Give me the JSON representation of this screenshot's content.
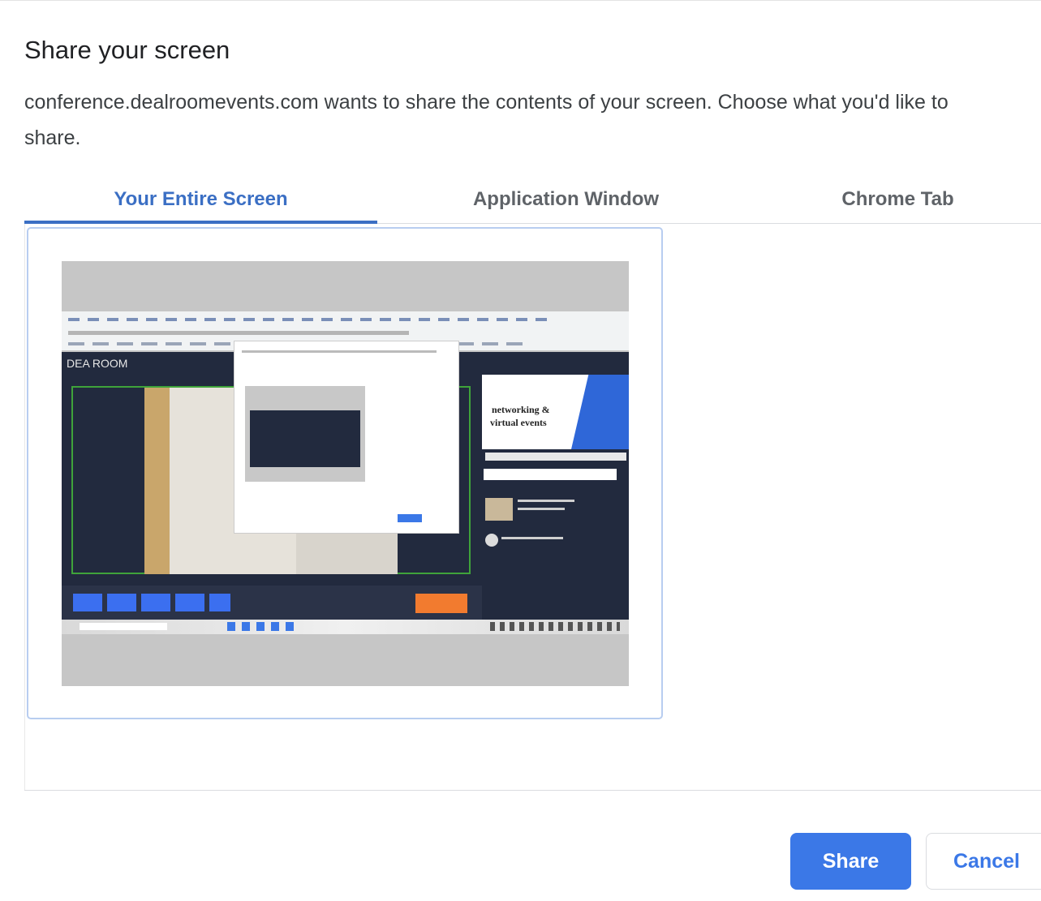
{
  "dialog": {
    "title": "Share your screen",
    "description": "conference.dealroomevents.com wants to share the contents of your screen. Choose what you'd like to share."
  },
  "tabs": [
    {
      "label": "Your Entire Screen",
      "selected": true
    },
    {
      "label": "Application Window",
      "selected": false
    },
    {
      "label": "Chrome Tab",
      "selected": false
    }
  ],
  "thumbnail": {
    "logo": "DEA ROOM",
    "promo_line1": "networking &",
    "promo_line2": "virtual events"
  },
  "buttons": {
    "share": "Share",
    "cancel": "Cancel"
  },
  "colors": {
    "accent": "#3b78e7",
    "tab_active": "#3b6fc4",
    "dark_panel": "#222a3e",
    "bar_accent": "#f27b2f"
  }
}
